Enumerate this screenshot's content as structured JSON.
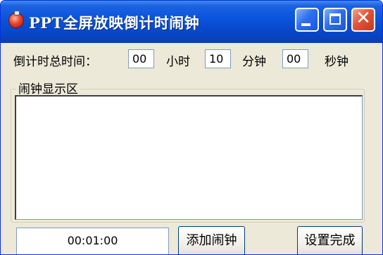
{
  "window": {
    "title": "PPT全屏放映倒计时闹钟"
  },
  "timer": {
    "label": "倒计时总时间：",
    "hours": "00",
    "hours_unit": "小时",
    "minutes": "10",
    "minutes_unit": "分钟",
    "seconds": "00",
    "seconds_unit": "秒钟"
  },
  "alarm_group": {
    "title": "闹钟显示区"
  },
  "bottom": {
    "alarm_time": "00:01:00",
    "add_alarm_label": "添加闹钟",
    "done_label": "设置完成"
  },
  "colors": {
    "titlebar": "#0a55dd",
    "close_button": "#e0543a",
    "face": "#ece9d8"
  }
}
